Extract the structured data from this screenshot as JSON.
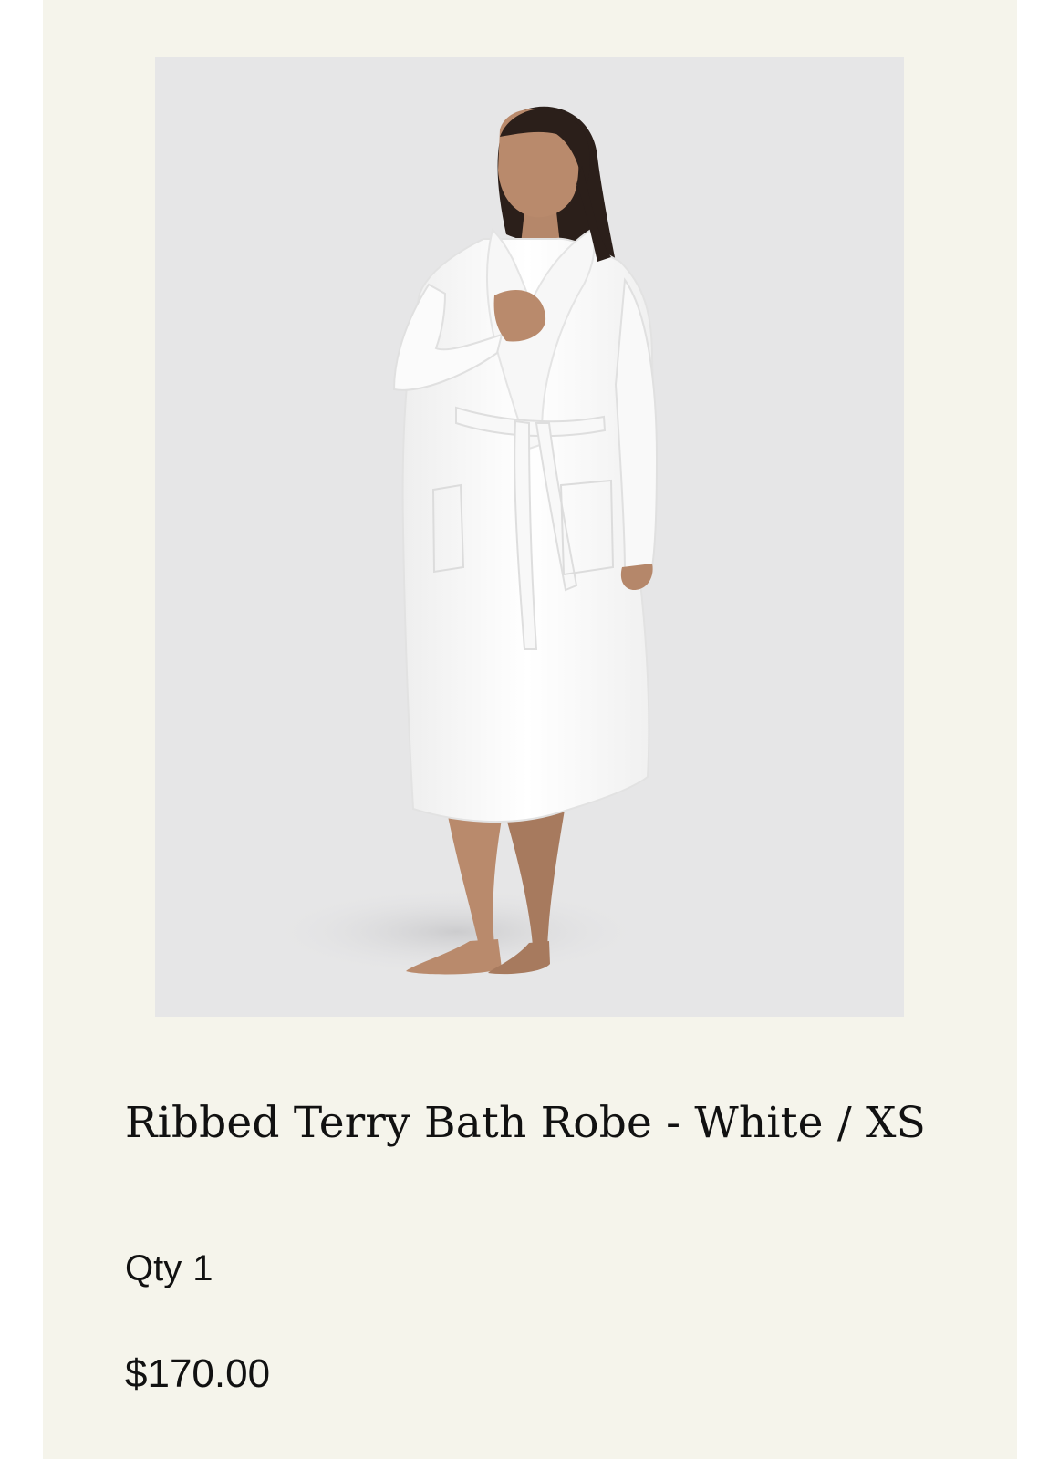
{
  "product": {
    "title": "Ribbed Terry Bath Robe - White / XS",
    "image_alt": "Woman wearing a white ribbed terry bath robe",
    "qty_label": "Qty",
    "qty_value": "1",
    "price": "$170.00"
  },
  "colors": {
    "page_background": "#f5f4eb",
    "image_background": "#e6e6e7",
    "text": "#111111"
  }
}
